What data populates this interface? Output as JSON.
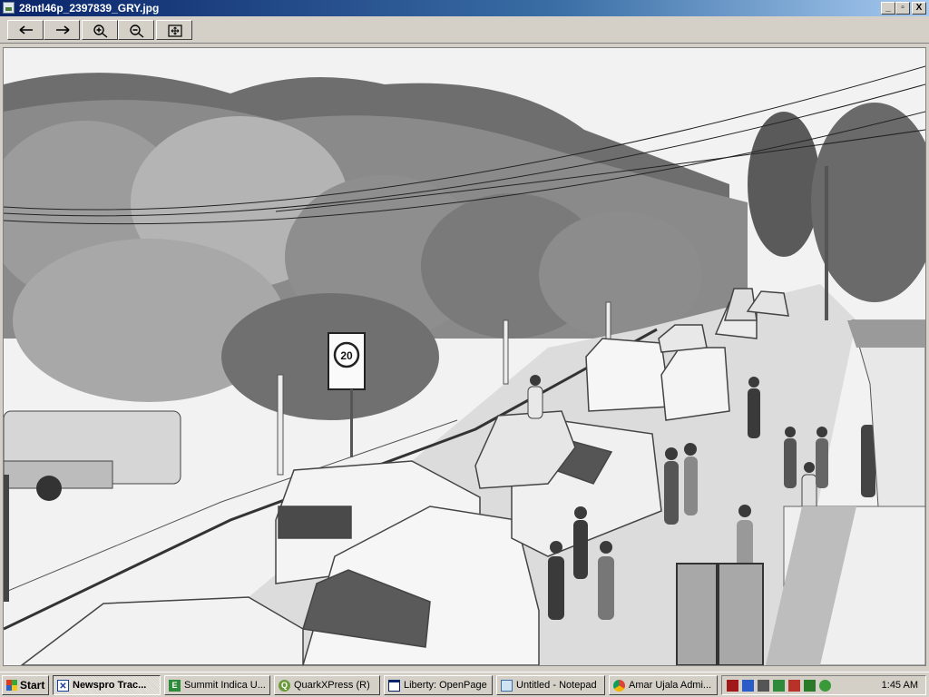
{
  "window": {
    "title": "28ntl46p_2397839_GRY.jpg",
    "controls": [
      "_",
      "▫",
      "X"
    ]
  },
  "toolbar": {
    "buttons": [
      {
        "name": "previous",
        "icon": "arrow-left-icon"
      },
      {
        "name": "next",
        "icon": "arrow-right-icon"
      },
      {
        "name": "zoom-in",
        "icon": "zoom-in-icon"
      },
      {
        "name": "zoom-out",
        "icon": "zoom-out-icon"
      },
      {
        "name": "fit",
        "icon": "fit-to-window-icon"
      }
    ]
  },
  "photo": {
    "subject": "grayscale street photo of a hill station road crowded with cars and pedestrians",
    "sign_text": "20"
  },
  "taskbar": {
    "start_label": "Start",
    "tasks": [
      {
        "label": "Newspro Trac...",
        "icon": "newspro-icon",
        "active": true
      },
      {
        "label": "Summit Indica U...",
        "icon": "summit-icon",
        "active": false
      },
      {
        "label": "QuarkXPress (R)",
        "icon": "quark-icon",
        "active": false
      },
      {
        "label": "Liberty: OpenPage",
        "icon": "window-icon",
        "active": false
      },
      {
        "label": "Untitled - Notepad",
        "icon": "notepad-icon",
        "active": false
      },
      {
        "label": "Amar Ujala Admi...",
        "icon": "chrome-icon",
        "active": false
      }
    ],
    "tray_icons": [
      "tray-app-icon",
      "network-icon",
      "volume-icon",
      "shield-icon",
      "security-icon",
      "vpn-icon",
      "update-icon"
    ],
    "clock": "1:45 AM"
  },
  "colors": {
    "titlebar_start": "#0a246a",
    "titlebar_end": "#a6caf0",
    "chrome": "#d4d0c8"
  }
}
